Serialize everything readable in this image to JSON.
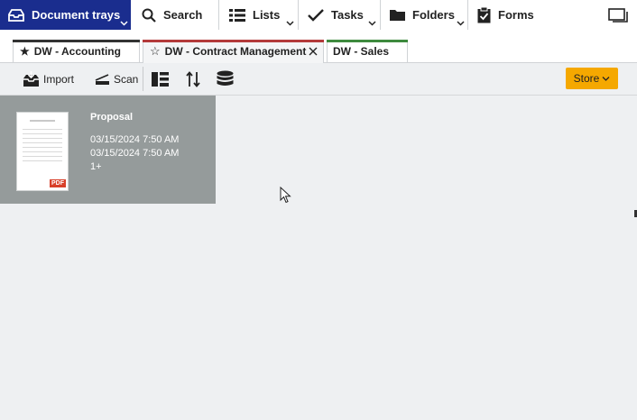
{
  "nav": {
    "items": [
      {
        "label": "Document trays",
        "icon": "tray-icon"
      },
      {
        "label": "Search",
        "icon": "search-icon"
      },
      {
        "label": "Lists",
        "icon": "list-icon"
      },
      {
        "label": "Tasks",
        "icon": "check-icon"
      },
      {
        "label": "Folders",
        "icon": "folder-icon"
      },
      {
        "label": "Forms",
        "icon": "clipboard-icon"
      }
    ],
    "window_icon": "window-icon"
  },
  "tabs": [
    {
      "label": "DW - Accounting",
      "color": "#333333",
      "star": "filled"
    },
    {
      "label": "DW - Contract Management",
      "color": "#b33a3a",
      "star": "outline"
    },
    {
      "label": "DW - Sales",
      "color": "#3e8a3e"
    }
  ],
  "toolbar": {
    "import_label": "Import",
    "scan_label": "Scan",
    "store_label": "Store"
  },
  "document": {
    "title": "Proposal",
    "date1": "03/15/2024 7:50 AM",
    "date2": "03/15/2024 7:50 AM",
    "count": "1+",
    "thumb_badge": "PDF"
  },
  "colors": {
    "accent": "#1a2d8e",
    "store": "#f5a800",
    "card": "#959b9b"
  }
}
